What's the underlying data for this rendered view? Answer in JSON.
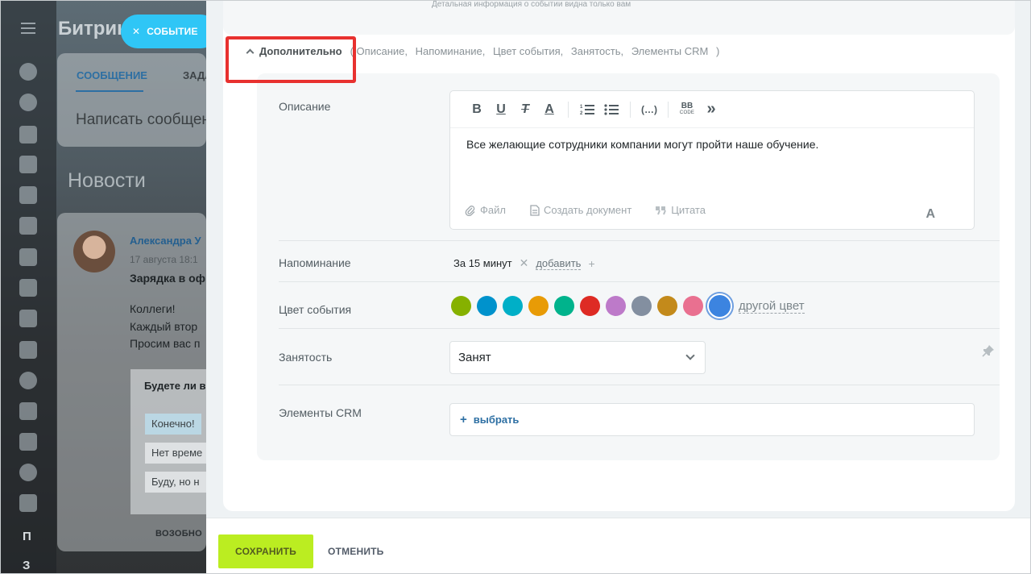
{
  "background": {
    "brand": "Битрикс",
    "event_pill": "событие",
    "tabs": [
      "СООБЩЕНИЕ",
      "ЗАДАЧА"
    ],
    "write_placeholder": "Написать сообщение",
    "news_title": "Новости",
    "post": {
      "author": "Александра У",
      "date": "17 августа 18:1",
      "title": "Зарядка в оф",
      "lines": [
        "Коллеги!",
        "Каждый втор",
        "Просим вас п"
      ],
      "poll_question": "Будете ли в",
      "poll_options": [
        "Конечно!",
        "Нет време",
        "Буду, но н"
      ],
      "more": "ВОЗОБНО"
    },
    "left_letters": [
      "П",
      "З"
    ]
  },
  "form": {
    "top_hint": "Детальная информация о событии видна только вам",
    "advanced": {
      "label": "Дополнительно",
      "open_paren": "(",
      "items": [
        "Описание,",
        "Напоминание,",
        "Цвет события,",
        "Занятость,",
        "Элементы CRM"
      ],
      "close_paren": ")"
    },
    "description": {
      "label": "Описание",
      "text": "Все желающие сотрудники компании могут пройти наше обучение.",
      "toolbar": {
        "bold": "B",
        "underline": "U",
        "clear": "T",
        "color": "A",
        "code": "(…)",
        "bbcode": "BB",
        "bbcode_sub": "CODE",
        "more": "»"
      },
      "actions": {
        "file": "Файл",
        "create_doc": "Создать документ",
        "quote": "Цитата"
      },
      "format_toggle": "A"
    },
    "reminder": {
      "label": "Напоминание",
      "value": "За 15 минут",
      "remove": "✕",
      "add": "добавить",
      "add_plus": "+"
    },
    "event_color": {
      "label": "Цвет события",
      "swatches": [
        "#86b100",
        "#0092cc",
        "#00afc7",
        "#e89b06",
        "#00b38c",
        "#de2b24",
        "#bd7ac9",
        "#838fa0",
        "#c38a1b",
        "#e97090"
      ],
      "selected": "#3c84e0",
      "other": "другой цвет"
    },
    "busy": {
      "label": "Занятость",
      "value": "Занят"
    },
    "crm": {
      "label": "Элементы CRM",
      "select_plus": "+",
      "select": "выбрать"
    }
  },
  "footer": {
    "save": "Сохранить",
    "cancel": "Отменить"
  }
}
